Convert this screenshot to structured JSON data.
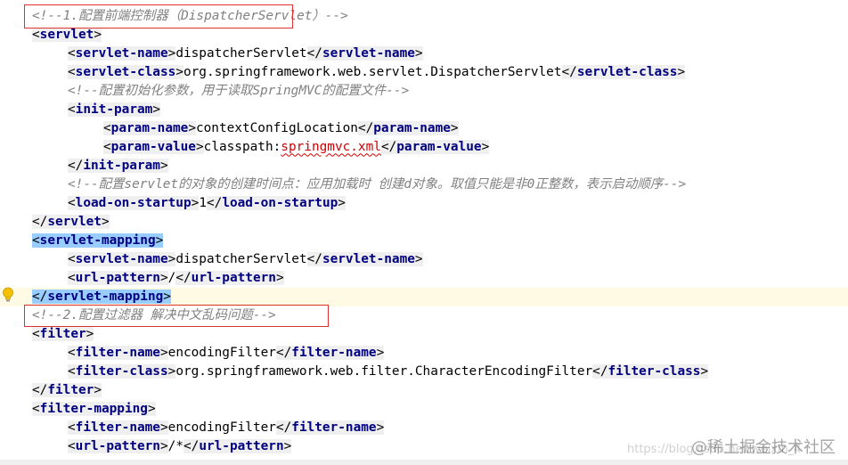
{
  "editor": {
    "lines": [
      {
        "indent": 0,
        "tokens": [
          {
            "t": "comment",
            "v": "<!--1.配置前端控制器（DispatcherServlet）-->"
          }
        ]
      },
      {
        "indent": 0,
        "tokens": [
          {
            "t": "bracket",
            "v": "<"
          },
          {
            "t": "tag",
            "v": "servlet"
          },
          {
            "t": "bracket",
            "v": ">"
          }
        ]
      },
      {
        "indent": 1,
        "tokens": [
          {
            "t": "bracket",
            "v": "<"
          },
          {
            "t": "tag",
            "v": "servlet-name"
          },
          {
            "t": "bracket",
            "v": ">"
          },
          {
            "t": "text",
            "v": "dispatcherServlet"
          },
          {
            "t": "bracket",
            "v": "</"
          },
          {
            "t": "tag",
            "v": "servlet-name"
          },
          {
            "t": "bracket",
            "v": ">"
          }
        ]
      },
      {
        "indent": 1,
        "tokens": [
          {
            "t": "bracket",
            "v": "<"
          },
          {
            "t": "tag",
            "v": "servlet-class"
          },
          {
            "t": "bracket",
            "v": ">"
          },
          {
            "t": "text",
            "v": "org.springframework.web.servlet.DispatcherServlet"
          },
          {
            "t": "bracket",
            "v": "</"
          },
          {
            "t": "tag",
            "v": "servlet-class"
          },
          {
            "t": "bracket",
            "v": ">"
          }
        ]
      },
      {
        "indent": 1,
        "tokens": [
          {
            "t": "comment",
            "v": "<!--配置初始化参数，用于读取SpringMVC的配置文件-->"
          }
        ]
      },
      {
        "indent": 1,
        "tokens": [
          {
            "t": "bracket",
            "v": "<"
          },
          {
            "t": "tag",
            "v": "init-param"
          },
          {
            "t": "bracket",
            "v": ">"
          }
        ]
      },
      {
        "indent": 2,
        "tokens": [
          {
            "t": "bracket",
            "v": "<"
          },
          {
            "t": "tag",
            "v": "param-name"
          },
          {
            "t": "bracket",
            "v": ">"
          },
          {
            "t": "text",
            "v": "contextConfigLocation"
          },
          {
            "t": "bracket",
            "v": "</"
          },
          {
            "t": "tag",
            "v": "param-name"
          },
          {
            "t": "bracket",
            "v": ">"
          }
        ]
      },
      {
        "indent": 2,
        "tokens": [
          {
            "t": "bracket",
            "v": "<"
          },
          {
            "t": "tag",
            "v": "param-value"
          },
          {
            "t": "bracket",
            "v": ">"
          },
          {
            "t": "text",
            "v": "classpath:"
          },
          {
            "t": "sq",
            "v": "springmvc.xml"
          },
          {
            "t": "bracket",
            "v": "</"
          },
          {
            "t": "tag",
            "v": "param-value"
          },
          {
            "t": "bracket",
            "v": ">"
          }
        ]
      },
      {
        "indent": 1,
        "tokens": [
          {
            "t": "bracket",
            "v": "</"
          },
          {
            "t": "tag",
            "v": "init-param"
          },
          {
            "t": "bracket",
            "v": ">"
          }
        ]
      },
      {
        "indent": 1,
        "tokens": [
          {
            "t": "comment",
            "v": "<!--配置servlet的对象的创建时间点：应用加载时 创建d对象。取值只能是非0正整数，表示启动顺序-->"
          }
        ]
      },
      {
        "indent": 1,
        "tokens": [
          {
            "t": "bracket",
            "v": "<"
          },
          {
            "t": "tag",
            "v": "load-on-startup"
          },
          {
            "t": "bracket",
            "v": ">"
          },
          {
            "t": "text",
            "v": "1"
          },
          {
            "t": "bracket",
            "v": "</"
          },
          {
            "t": "tag",
            "v": "load-on-startup"
          },
          {
            "t": "bracket",
            "v": ">"
          }
        ]
      },
      {
        "indent": 0,
        "tokens": [
          {
            "t": "bracket",
            "v": "</"
          },
          {
            "t": "tag",
            "v": "servlet"
          },
          {
            "t": "bracket",
            "v": ">"
          }
        ]
      },
      {
        "indent": 0,
        "highlight": true,
        "tokens": [
          {
            "t": "bracket",
            "v": "<"
          },
          {
            "t": "tag",
            "v": "servlet-mapping"
          },
          {
            "t": "bracket",
            "v": ">"
          }
        ]
      },
      {
        "indent": 1,
        "tokens": [
          {
            "t": "bracket",
            "v": "<"
          },
          {
            "t": "tag",
            "v": "servlet-name"
          },
          {
            "t": "bracket",
            "v": ">"
          },
          {
            "t": "text",
            "v": "dispatcherServlet"
          },
          {
            "t": "bracket",
            "v": "</"
          },
          {
            "t": "tag",
            "v": "servlet-name"
          },
          {
            "t": "bracket",
            "v": ">"
          }
        ]
      },
      {
        "indent": 1,
        "tokens": [
          {
            "t": "bracket",
            "v": "<"
          },
          {
            "t": "tag",
            "v": "url-pattern"
          },
          {
            "t": "bracket",
            "v": ">"
          },
          {
            "t": "text",
            "v": "/"
          },
          {
            "t": "bracket",
            "v": "</"
          },
          {
            "t": "tag",
            "v": "url-pattern"
          },
          {
            "t": "bracket",
            "v": ">"
          }
        ]
      },
      {
        "indent": 0,
        "highlight": true,
        "caret": true,
        "tokens": [
          {
            "t": "bracket",
            "v": "</"
          },
          {
            "t": "tag",
            "v": "servlet-mapping"
          },
          {
            "t": "bracket",
            "v": ">"
          }
        ]
      },
      {
        "indent": 0,
        "tokens": [
          {
            "t": "comment",
            "v": "<!--2.配置过滤器 解决中文乱码问题-->"
          }
        ]
      },
      {
        "indent": 0,
        "tokens": [
          {
            "t": "bracket",
            "v": "<"
          },
          {
            "t": "tag",
            "v": "filter"
          },
          {
            "t": "bracket",
            "v": ">"
          }
        ]
      },
      {
        "indent": 1,
        "tokens": [
          {
            "t": "bracket",
            "v": "<"
          },
          {
            "t": "tag",
            "v": "filter-name"
          },
          {
            "t": "bracket",
            "v": ">"
          },
          {
            "t": "text",
            "v": "encodingFilter"
          },
          {
            "t": "bracket",
            "v": "</"
          },
          {
            "t": "tag",
            "v": "filter-name"
          },
          {
            "t": "bracket",
            "v": ">"
          }
        ]
      },
      {
        "indent": 1,
        "tokens": [
          {
            "t": "bracket",
            "v": "<"
          },
          {
            "t": "tag",
            "v": "filter-class"
          },
          {
            "t": "bracket",
            "v": ">"
          },
          {
            "t": "text",
            "v": "org.springframework.web.filter.CharacterEncodingFilter"
          },
          {
            "t": "bracket",
            "v": "</"
          },
          {
            "t": "tag",
            "v": "filter-class"
          },
          {
            "t": "bracket",
            "v": ">"
          }
        ]
      },
      {
        "indent": 0,
        "tokens": [
          {
            "t": "bracket",
            "v": "</"
          },
          {
            "t": "tag",
            "v": "filter"
          },
          {
            "t": "bracket",
            "v": ">"
          }
        ]
      },
      {
        "indent": 0,
        "tokens": [
          {
            "t": "bracket",
            "v": "<"
          },
          {
            "t": "tag",
            "v": "filter-mapping"
          },
          {
            "t": "bracket",
            "v": ">"
          }
        ]
      },
      {
        "indent": 1,
        "tokens": [
          {
            "t": "bracket",
            "v": "<"
          },
          {
            "t": "tag",
            "v": "filter-name"
          },
          {
            "t": "bracket",
            "v": ">"
          },
          {
            "t": "text",
            "v": "encodingFilter"
          },
          {
            "t": "bracket",
            "v": "</"
          },
          {
            "t": "tag",
            "v": "filter-name"
          },
          {
            "t": "bracket",
            "v": ">"
          }
        ]
      },
      {
        "indent": 1,
        "tokens": [
          {
            "t": "bracket",
            "v": "<"
          },
          {
            "t": "tag",
            "v": "url-pattern"
          },
          {
            "t": "bracket",
            "v": ">"
          },
          {
            "t": "text",
            "v": "/*"
          },
          {
            "t": "bracket",
            "v": "</"
          },
          {
            "t": "tag",
            "v": "url-pattern"
          },
          {
            "t": "bracket",
            "v": ">"
          }
        ]
      }
    ]
  },
  "gutter": {
    "bulb_icon": "lightbulb-icon"
  },
  "colors": {
    "tag": "#000080",
    "comment": "#808080",
    "error": "#d00000",
    "match_highlight": "#99ccff",
    "caret_line": "#fffae3",
    "annotation_box": "#e03030"
  },
  "watermark": {
    "brand": "@稀土掘金技术社区",
    "url": "https://blog.csdn.net/weixin_4"
  }
}
